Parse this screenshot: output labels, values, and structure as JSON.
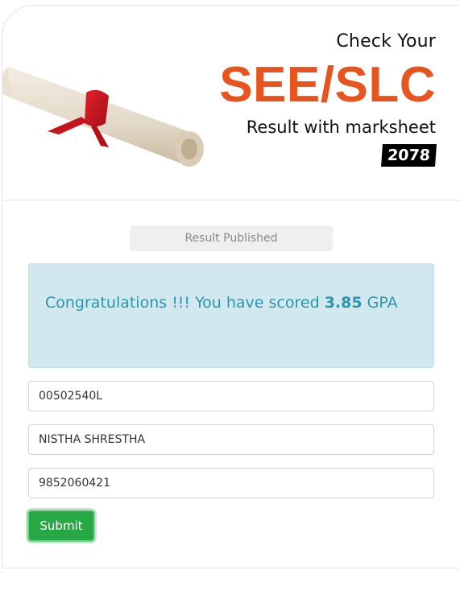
{
  "hero": {
    "line1": "Check Your",
    "exam": "SEE/SLC",
    "line3": "Result with marksheet",
    "year": "2078",
    "accent_color": "#e8541d",
    "image": "rolled-diploma-with-red-ribbon"
  },
  "status": {
    "label": "Result Published"
  },
  "result": {
    "message": "Congratulations !!! You have scored",
    "gpa": "3.85",
    "unit": "GPA"
  },
  "form": {
    "symbol_number": "00502540L",
    "name": "NISTHA SHRESTHA",
    "phone": "9852060421",
    "submit_label": "Submit"
  }
}
